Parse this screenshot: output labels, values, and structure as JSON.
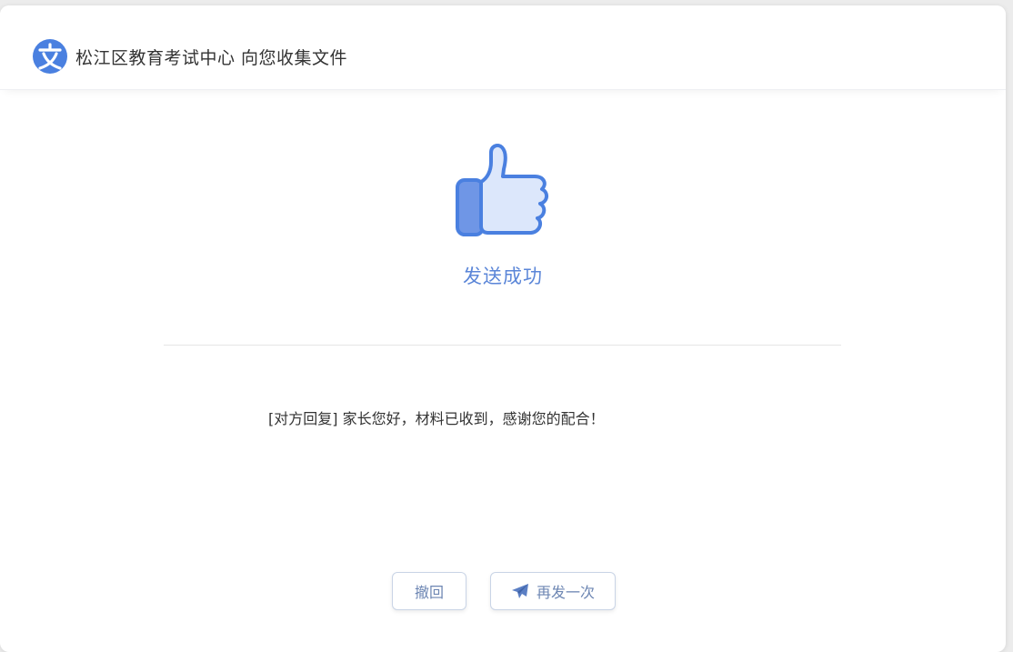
{
  "header": {
    "title": "松江区教育考试中心 向您收集文件",
    "logo_icon": "wen-character-logo",
    "brand_color": "#4a80e0"
  },
  "status": {
    "icon": "thumbs-up-icon",
    "text": "发送成功",
    "color": "#5b86d8"
  },
  "reply": {
    "text": "[对方回复] 家长您好，材料已收到，感谢您的配合！"
  },
  "actions": {
    "withdraw_label": "撤回",
    "resend_label": "再发一次",
    "resend_icon": "paper-plane-icon"
  }
}
